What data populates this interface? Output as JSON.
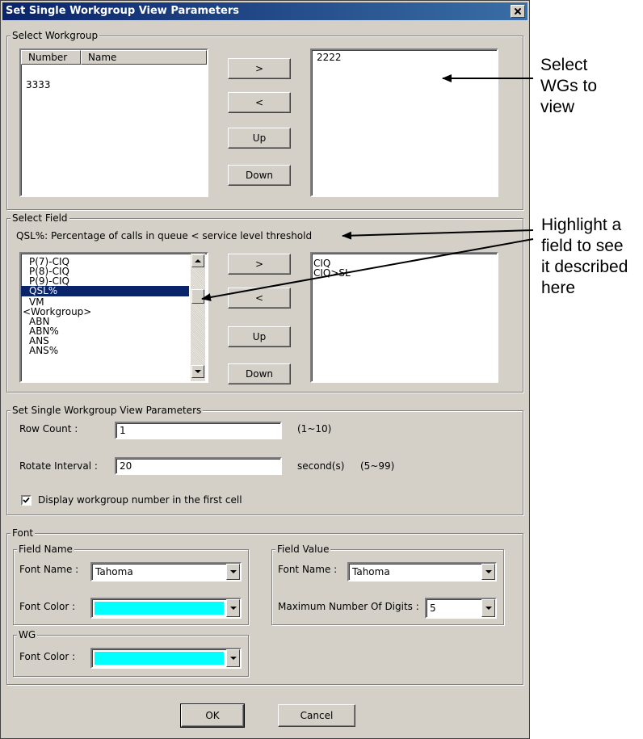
{
  "dialog": {
    "title": "Set Single Workgroup View Parameters"
  },
  "select_workgroup": {
    "legend": "Select Workgroup",
    "columns": [
      "Number",
      "Name"
    ],
    "available": [
      "3333"
    ],
    "selected": [
      "2222"
    ],
    "buttons": {
      "add": ">",
      "remove": "<",
      "up": "Up",
      "down": "Down"
    }
  },
  "select_field": {
    "legend": "Select Field",
    "description": "QSL%: Percentage of calls in queue < service level threshold",
    "available": [
      "P(7)-CIQ",
      "P(8)-CIQ",
      "P(9)-CIQ",
      "QSL%",
      "VM",
      "<Workgroup>",
      "ABN",
      "ABN%",
      "ANS",
      "ANS%"
    ],
    "highlighted": "QSL%",
    "selected": [
      "CIQ",
      "CIQ>SL"
    ],
    "buttons": {
      "add": ">",
      "remove": "<",
      "up": "Up",
      "down": "Down"
    }
  },
  "params": {
    "legend": "Set Single Workgroup View Parameters",
    "row_count_label": "Row Count :",
    "row_count_value": "1",
    "row_count_range": "(1~10)",
    "rotate_label": "Rotate Interval :",
    "rotate_value": "20",
    "rotate_unit": "second(s)",
    "rotate_range": "(5~99)",
    "display_wg_label": "Display workgroup number in the first cell",
    "display_wg_checked": true
  },
  "font": {
    "legend": "Font",
    "field_name": {
      "legend": "Field Name",
      "font_name_label": "Font Name :",
      "font_name_value": "Tahoma",
      "font_color_label": "Font Color :",
      "font_color": "#00ffff"
    },
    "field_value": {
      "legend": "Field Value",
      "font_name_label": "Font Name :",
      "font_name_value": "Tahoma",
      "max_digits_label": "Maximum Number Of Digits :",
      "max_digits_value": "5"
    },
    "wg": {
      "legend": "WG",
      "font_color_label": "Font Color :",
      "font_color": "#00ffff"
    }
  },
  "footer": {
    "ok": "OK",
    "cancel": "Cancel"
  },
  "annotations": {
    "select_wgs": [
      "Select",
      "WGs to",
      "view"
    ],
    "highlight_field": [
      "Highlight a",
      "field to see",
      "it described",
      "here"
    ]
  },
  "colors": {
    "highlight_bg": "#0a246a",
    "highlight_fg": "#ffffff",
    "title_bg": "#0a246a"
  }
}
